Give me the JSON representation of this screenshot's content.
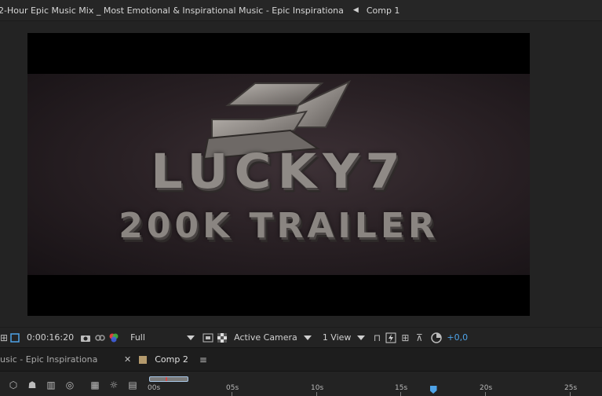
{
  "breadcrumb": {
    "parent": "2-Hour Epic Music Mix _ Most Emotional & Inspirational Music - Epic Inspirationa",
    "current": "Comp 1"
  },
  "viewer": {
    "logo_main": "LUCKY7",
    "logo_sub": "200K TRAILER",
    "timecode": "0:00:16:20",
    "resolution": "Full",
    "camera": "Active Camera",
    "views": "1 View",
    "exposure": "+0,0"
  },
  "tabs": {
    "left_tab": "usic - Epic Inspirationa",
    "active_tab": "Comp 2"
  },
  "timeline": {
    "ticks": [
      "00s",
      "05s",
      "10s",
      "15s",
      "20s",
      "25s"
    ],
    "playhead_seconds": 16.8
  },
  "colors": {
    "accent": "#4ea3e8",
    "comp_swatch": "#b49a6d"
  }
}
